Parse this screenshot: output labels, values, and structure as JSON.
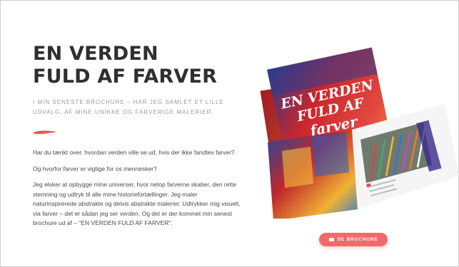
{
  "hero": {
    "title_line1": "EN VERDEN",
    "title_line2": "FULD AF FARVER",
    "subtitle": "I MIN SENESTE BROCHURE – HAR JEG SAMLET ET LILLE UDVALG, AF MINE UNIKKE OG FARVERIGE MALERIER.",
    "paragraphs": [
      "Har du tænkt over, hvordan verden ville se ud, hvis der ikke fandtes farver?",
      "Og hvorfor farver er vigtige for os mennesker?",
      "Jeg elsker at opbygge mine universer, hvor netop farverne skaber, den rette stemning og udtryk til alle mine historiefortællinger. Jeg maler naturinspirerede abstrakte og delvis abstrakte malerier. Udtrykker mig visuelt, via farver – det er sådan jeg ser verden. Og det er der kommet min senest brochure ud af – \"EN VERDEN FULD AF FARVER\"."
    ]
  },
  "brochure": {
    "cover_line1": "EN VERDEN",
    "cover_line2": "FULD AF",
    "cover_line3": "farver"
  },
  "cta": {
    "label": "SE BROCHURE",
    "icon": "book-icon"
  },
  "colors": {
    "accent": "#f16a6a",
    "cover_red": "#c8262c"
  }
}
